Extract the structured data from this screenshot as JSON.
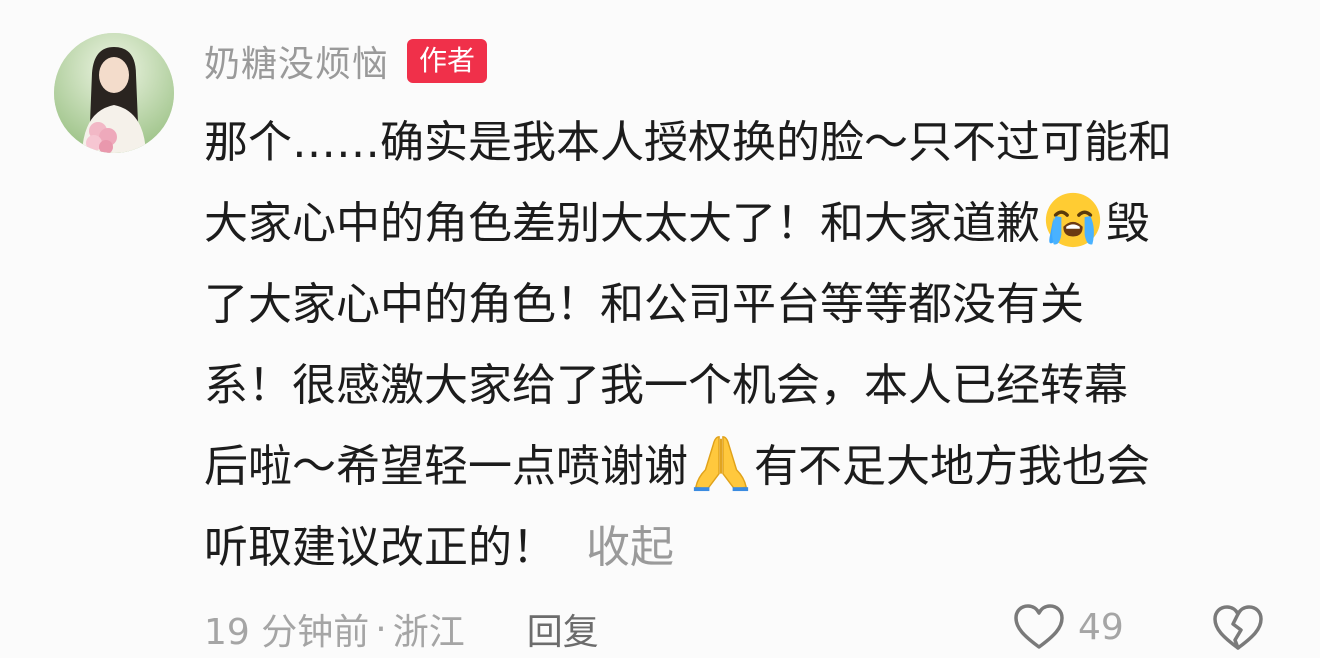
{
  "comment": {
    "author": {
      "name": "奶糖没烦恼",
      "badge": "作者",
      "avatar_icon": "avatar-photo"
    },
    "text_lines": [
      [
        "那个……确实是我本人授权换的脸～只不过可能和"
      ],
      [
        "大家心中的角色差别大太大了！和大家道歉",
        "毁"
      ],
      [
        "了大家心中的角色！和公司平台等等都没有关"
      ],
      [
        "系！很感激大家给了我一个机会，本人已经转幕"
      ],
      [
        "后啦～希望轻一点喷谢谢",
        "有不足大地方我也会"
      ],
      [
        "听取建议改正的！"
      ]
    ],
    "emojis": {
      "crying": "loudly-crying-face-icon",
      "praying": "folded-hands-icon"
    },
    "collapse_label": "收起",
    "time": "19 分钟前",
    "separator": "·",
    "location": "浙江",
    "reply_label": "回复",
    "like_count": "49",
    "colors": {
      "badge": "#f0304a",
      "meta_gray": "#9a9a9a",
      "text": "#1c1c1c",
      "background": "#fbfbfb"
    }
  }
}
